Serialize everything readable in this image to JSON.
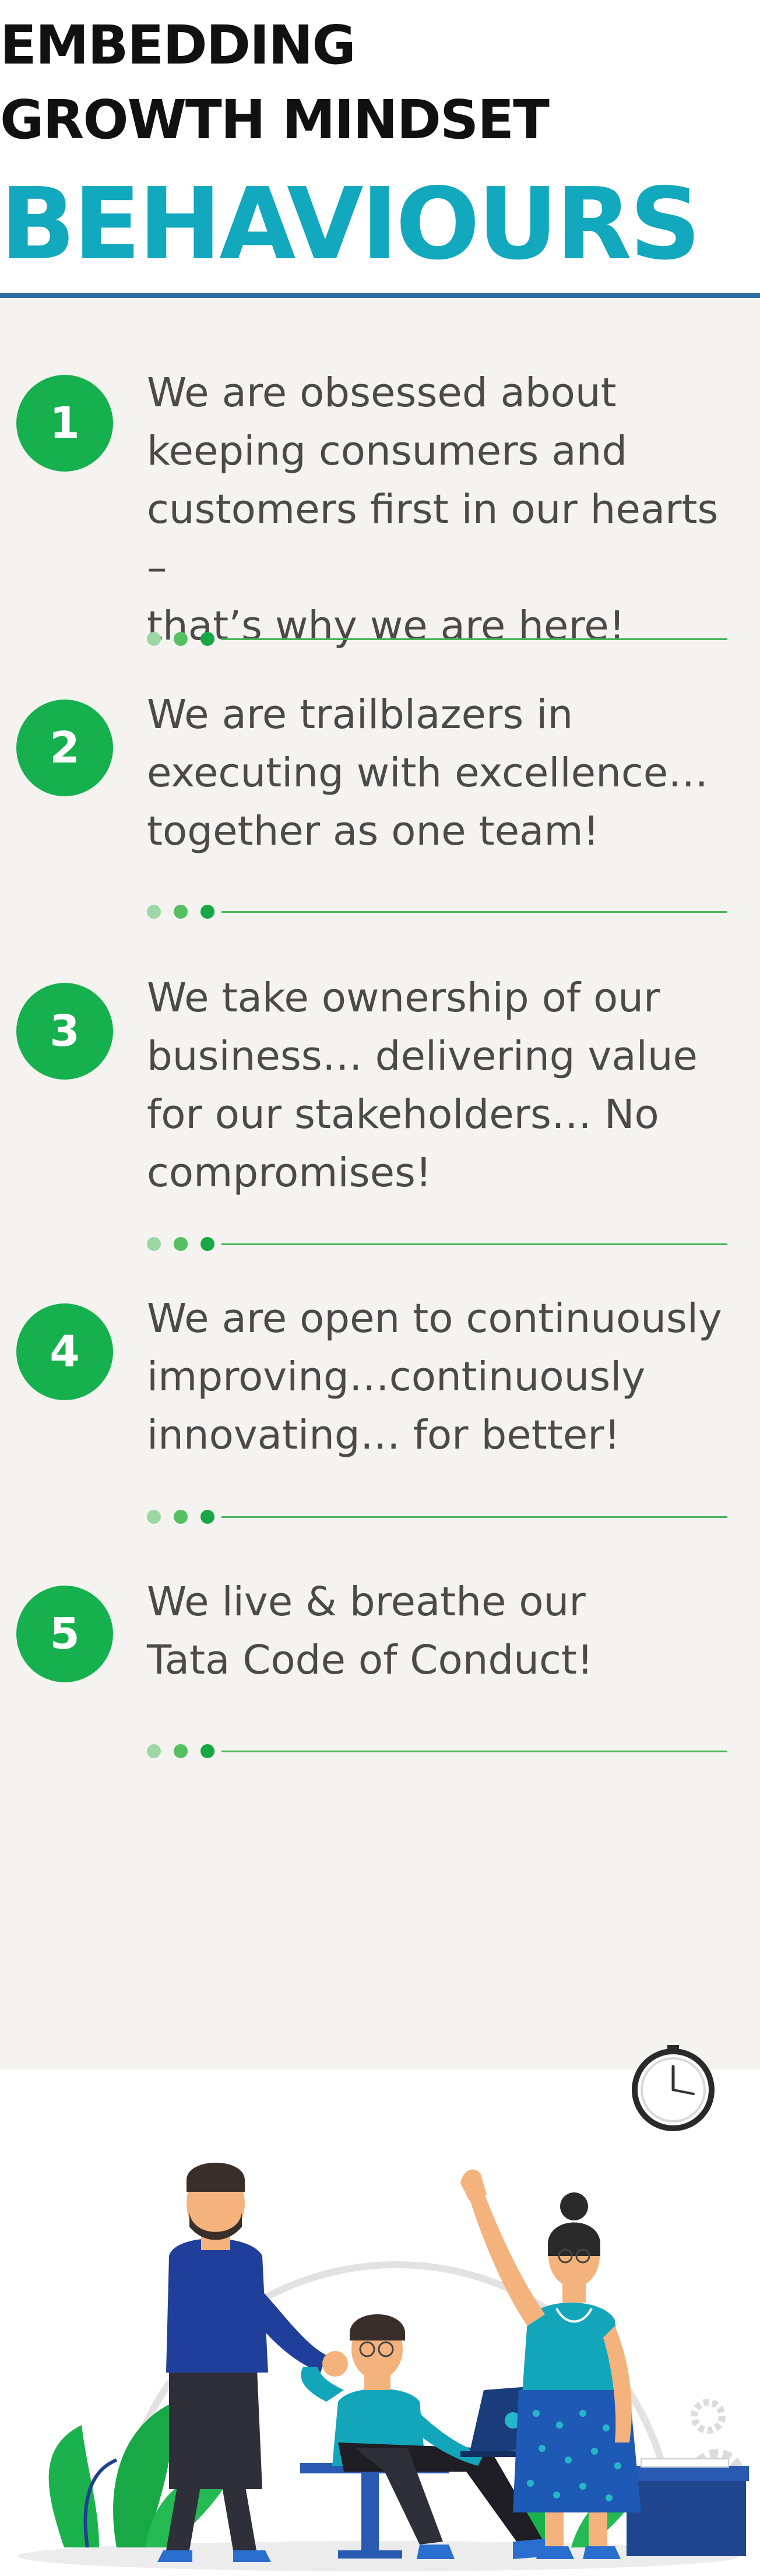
{
  "header": {
    "line1": "EMBEDDING",
    "line2": "GROWTH MINDSET",
    "line3": "BEHAVIOURS"
  },
  "behaviours": [
    {
      "number": "1",
      "lines": [
        "We are obsessed about",
        "keeping consumers and",
        "customers first in our hearts –",
        "that’s why we are here!"
      ]
    },
    {
      "number": "2",
      "lines": [
        "We are trailblazers in",
        "executing with excellence…",
        "together as one team!"
      ]
    },
    {
      "number": "3",
      "lines": [
        "We take ownership of our",
        "business… delivering value",
        "for our stakeholders… No",
        "compromises!"
      ]
    },
    {
      "number": "4",
      "lines": [
        "We are open to continuously",
        "improving…continuously",
        "innovating… for better!"
      ]
    },
    {
      "number": "5",
      "lines": [
        "We live & breathe our",
        "Tata Code of Conduct!"
      ]
    }
  ],
  "colors": {
    "number_badge": "#17b04e",
    "title_accent": "#12a8bd",
    "rule": "#2e6da4",
    "panel": "#f4f3f0"
  }
}
